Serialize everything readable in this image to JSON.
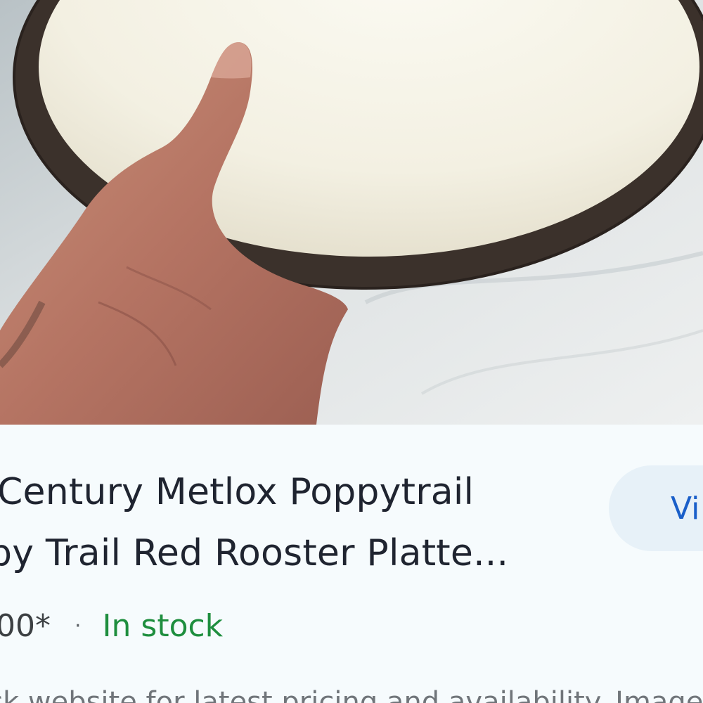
{
  "product": {
    "image_alt": "Hand holding a white plate with dark brown rim",
    "title_line1": "Century Metlox Poppytrail",
    "title_line2": "py Trail Red Rooster Platte...",
    "price": "00*",
    "separator": "·",
    "availability": "In stock",
    "disclaimer": "ck website for latest pricing and availability. Images m"
  },
  "actions": {
    "visit_label": "Vi"
  },
  "colors": {
    "background": "#f6fbfd",
    "title": "#1f2430",
    "in_stock": "#1e8e3e",
    "visit_text": "#1a5fc9",
    "visit_bg": "#e7f1f8",
    "muted": "#70757a"
  }
}
